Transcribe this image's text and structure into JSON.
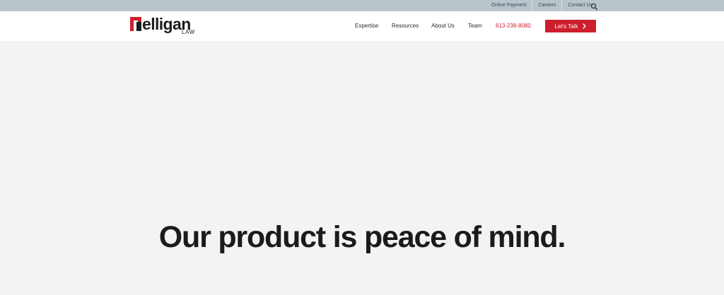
{
  "utility_bar": {
    "links": [
      "Online Payment",
      "Careers",
      "Contact Us"
    ],
    "search_icon": "search-icon"
  },
  "header": {
    "logo": {
      "text": "elligan",
      "subtext": "LAW",
      "mark_color": "#cd1f2d"
    },
    "nav": [
      "Expertise",
      "Resources",
      "About Us",
      "Team"
    ],
    "phone": "613-238-8080",
    "cta_label": "Let's Talk",
    "cta_icon": "chevron-right-icon"
  },
  "hero": {
    "title": "Our product is peace of mind."
  },
  "colors": {
    "accent": "#cd1f2d",
    "utility_bar_bg": "#b9c4cb",
    "hero_bg": "#f3f3f3"
  }
}
